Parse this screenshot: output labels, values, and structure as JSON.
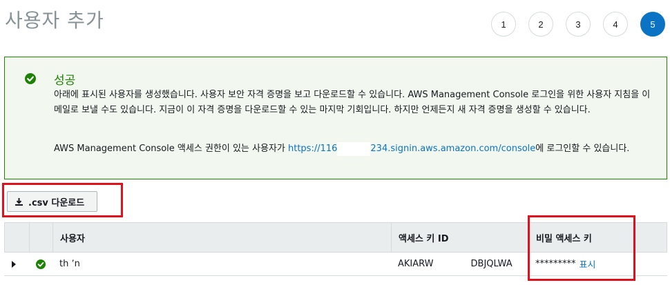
{
  "page": {
    "title": "사용자 추가"
  },
  "steps": [
    "1",
    "2",
    "3",
    "4",
    "5"
  ],
  "active_step": 5,
  "success": {
    "title": "성공",
    "message": "아래에 표시된 사용자를 생성했습니다. 사용자 보안 자격 증명을 보고 다운로드할 수 있습니다. AWS Management Console 로그인을 위한 사용자 지침을 이메일로 보낼 수도 있습니다. 지금이 이 자격 증명을 다운로드할 수 있는 마지막 기회입니다. 하지만 언제든지 새 자격 증명을 생성할 수 있습니다.",
    "access_prefix": "AWS Management Console 액세스 권한이 있는 사용자가 ",
    "access_link_start": "https://116",
    "access_link_end": "234.signin.aws.amazon.com/console",
    "access_suffix": "에 로그인할 수 있습니다."
  },
  "toolbar": {
    "csv_label": ".csv 다운로드"
  },
  "table": {
    "headers": [
      "사용자",
      "액세스 키 ID",
      "비밀 액세스 키"
    ],
    "rows": [
      {
        "user": "th  ʼn",
        "key_start": "AKIARW",
        "key_end": "DBJQLWA",
        "secret": "*********",
        "show_label": "표시"
      }
    ]
  },
  "colors": {
    "accent": "#0a73c4",
    "success": "#1d8102",
    "highlight": "#e0101c"
  }
}
